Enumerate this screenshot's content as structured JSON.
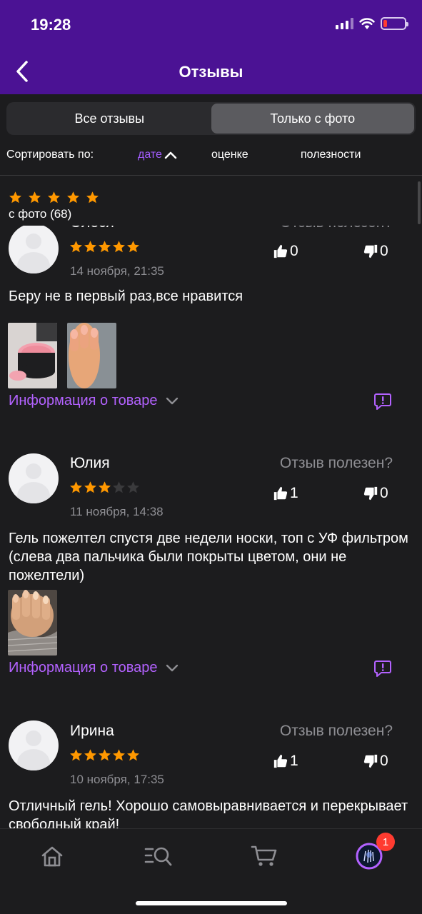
{
  "status_bar": {
    "time": "19:28"
  },
  "header": {
    "title": "Отзывы"
  },
  "tabs": [
    {
      "label": "Все отзывы",
      "active": false
    },
    {
      "label": "Только с фото",
      "active": true
    }
  ],
  "sort": {
    "label": "Сортировать по:",
    "options": [
      {
        "label": "дате",
        "active": true
      },
      {
        "label": "оценке",
        "active": false
      },
      {
        "label": "полезности",
        "active": false
      }
    ]
  },
  "filter": {
    "rating": 5,
    "count_label": "с фото (68)"
  },
  "reviews": [
    {
      "author": "Олеся",
      "rating": 5,
      "date": "14 ноября, 21:35",
      "helpful_label": "Отзыв полезен?",
      "likes": "0",
      "dislikes": "0",
      "text": "Беру не в первый раз,все нравится",
      "info_link": "Информация о товаре"
    },
    {
      "author": "Юлия",
      "rating": 3,
      "date": "11 ноября, 14:38",
      "helpful_label": "Отзыв полезен?",
      "likes": "1",
      "dislikes": "0",
      "text": "Гель пожелтел спустя две недели носки, топ с УФ фильтром (слева два пальчика были покрыты цветом, они не пожелтели)",
      "info_link": "Информация о товаре"
    },
    {
      "author": "Ирина",
      "rating": 5,
      "date": "10 ноября, 17:35",
      "helpful_label": "Отзыв полезен?",
      "likes": "1",
      "dislikes": "0",
      "text": "Отличный гель! Хорошо самовыравнивается и перекрывает свободный край!"
    }
  ],
  "bottom_nav": {
    "items": [
      "home-icon",
      "catalog-search-icon",
      "cart-icon",
      "profile-avatar"
    ],
    "profile_badge": "1"
  },
  "colors": {
    "header_bg": "#4b1294",
    "accent": "#b362ff",
    "star": "#ff9800",
    "badge": "#ff3b30"
  }
}
